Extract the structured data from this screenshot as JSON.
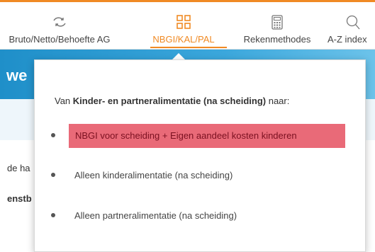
{
  "colors": {
    "accent": "#f08a24",
    "highlight": "#e96a78"
  },
  "nav": {
    "items": [
      {
        "label": "Bruto/Netto/Behoefte AG",
        "icon": "transfer-arrows-icon"
      },
      {
        "label": "NBGI/KAL/PAL",
        "icon": "grid-icon",
        "active": true
      },
      {
        "label": "Rekenmethodes",
        "icon": "calculator-icon"
      },
      {
        "label": "A-Z index",
        "icon": "search-icon"
      }
    ]
  },
  "background": {
    "heading_fragment": "we",
    "text1": "de ha",
    "text2": "enstb"
  },
  "dropdown": {
    "intro_prefix": "Van ",
    "intro_bold": "Kinder- en partneralimentatie (na scheiding)",
    "intro_suffix": " naar:",
    "options": [
      {
        "label": "NBGI voor scheiding + Eigen aandeel kosten kinderen",
        "highlighted": true
      },
      {
        "label": "Alleen kinderalimentatie (na scheiding)"
      },
      {
        "label": "Alleen partneralimentatie (na scheiding)"
      }
    ]
  }
}
